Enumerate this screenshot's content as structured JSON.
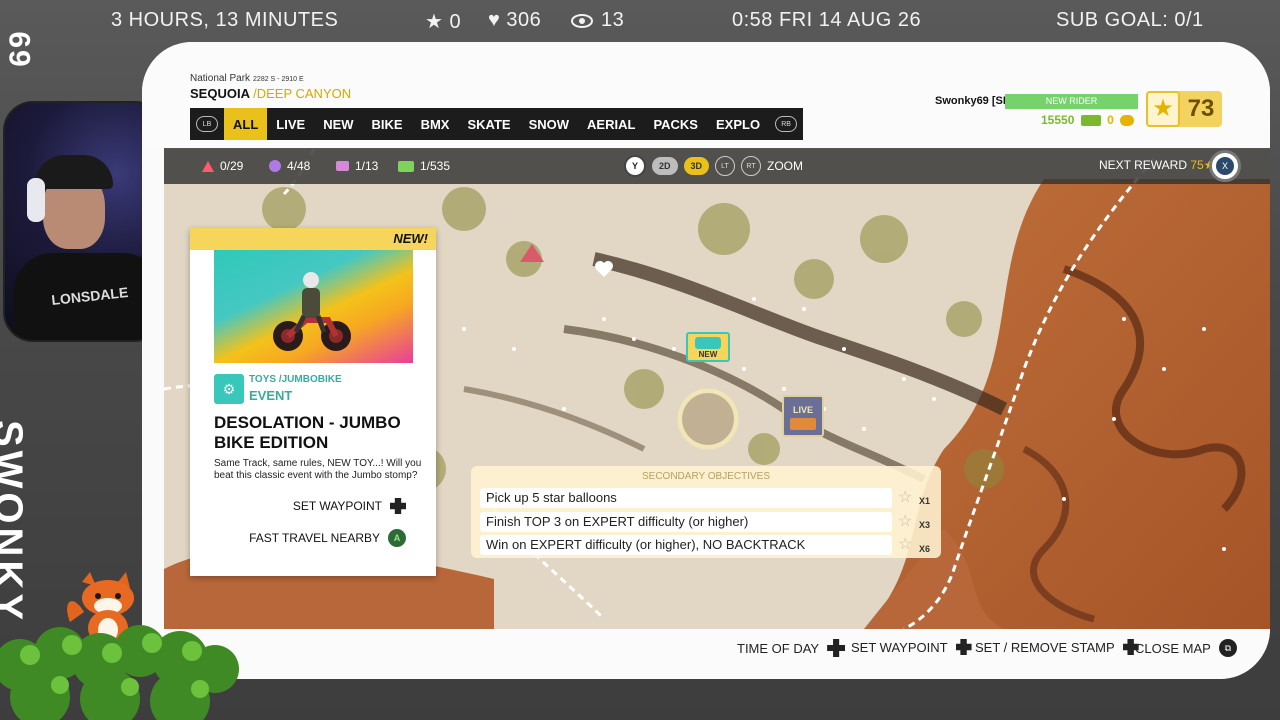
{
  "stream": {
    "uptime": "3 HOURS, 13 MINUTES",
    "stars": "★ 0",
    "hearts": "♥ 306",
    "viewers": "13",
    "clock": "0:58 FRI 14 AUG 26",
    "sub_goal": "SUB GOAL: 0/1",
    "handle": "69",
    "channel_name": "SWONKY",
    "webcam_shirt": "LONSDALE"
  },
  "location": {
    "region": "National Park",
    "coords": "2282 S - 2910 E",
    "name": "SEQUOIA",
    "sub": "/DEEP CANYON"
  },
  "tabs": {
    "lb": "LB",
    "items": [
      "ALL",
      "LIVE",
      "NEW",
      "BIKE",
      "BMX",
      "SKATE",
      "SNOW",
      "AERIAL",
      "PACKS",
      "EXPLO"
    ],
    "active": "ALL",
    "rb": "RB"
  },
  "player": {
    "name": "Swonky69 [SF]",
    "rank": "NEW RIDER",
    "credits": "15550",
    "tokens": "0",
    "level": "73"
  },
  "hud": {
    "triangles": "0/29",
    "circles": "4/48",
    "boxes": "1/13",
    "tickets": "1/535",
    "btn_y": "Y",
    "zoom_2d": "2D",
    "zoom_3d": "3D",
    "btn_lt": "LT",
    "btn_rt": "RT",
    "zoom_label": "ZOOM",
    "next_reward_label": "NEXT REWARD",
    "next_reward_value": "75",
    "close_btn": "X"
  },
  "event_card": {
    "new_tag": "NEW!",
    "category": "TOYS",
    "subcategory": "/JUMBOBIKE",
    "type": "EVENT",
    "title": "DESOLATION - JUMBO BIKE EDITION",
    "description": "Same Track, same rules, NEW TOY...! Will you beat this classic event with the Jumbo stomp?",
    "set_waypoint": "SET WAYPOINT",
    "fast_travel": "FAST TRAVEL NEARBY",
    "btn_a": "A"
  },
  "objectives": {
    "heading": "SECONDARY OBJECTIVES",
    "items": [
      {
        "text": "Pick up 5 star balloons",
        "mult": "X1"
      },
      {
        "text": "Finish TOP 3 on EXPERT difficulty (or higher)",
        "mult": "X3"
      },
      {
        "text": "Win on EXPERT difficulty (or higher), NO BACKTRACK",
        "mult": "X6"
      }
    ]
  },
  "map_markers": {
    "new_marker": "NEW",
    "live_marker": "LIVE"
  },
  "bottom_bar": {
    "time_of_day": "TIME OF DAY",
    "set_waypoint": "SET WAYPOINT",
    "stamp": "SET / REMOVE STAMP",
    "close_map": "CLOSE MAP"
  },
  "colors": {
    "accent_yellow": "#e9c11a",
    "teal": "#3ac7bb",
    "rank_green": "#76d36c",
    "hud_dark": "#323232"
  }
}
